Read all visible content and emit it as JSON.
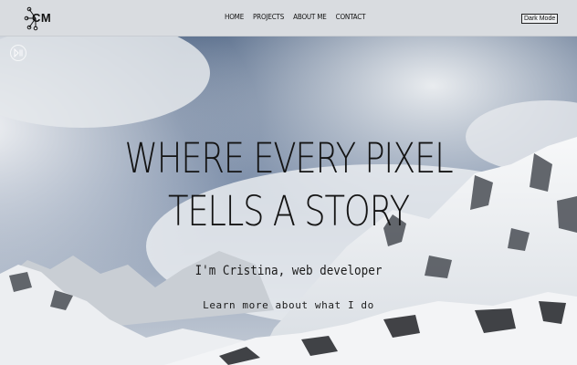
{
  "header": {
    "logo_text": "CM",
    "nav": [
      "HOME",
      "PROJECTS",
      "ABOUT ME",
      "CONTACT"
    ],
    "dark_mode_label": "Dark Mode"
  },
  "hero": {
    "headline": "WHERE EVERY PIXEL TELLS A STORY",
    "subheadline": "I'm Cristina, web developer",
    "cta": "Learn more about what I do",
    "play_icon": "play-pause-icon"
  },
  "colors": {
    "header_bg": "#d9dce0",
    "sky": "#5a6f8e",
    "text": "#141414"
  }
}
